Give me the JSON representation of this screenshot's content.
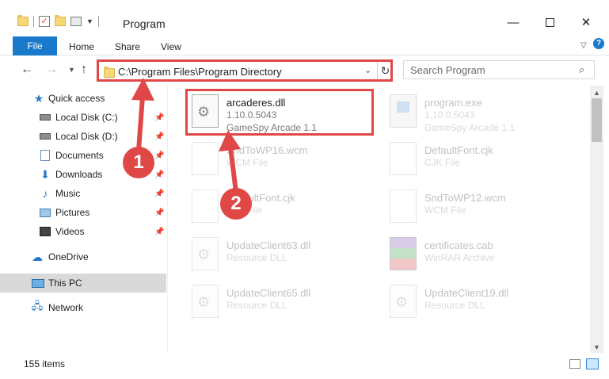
{
  "window": {
    "title": "Program",
    "minimize_glyph": "—",
    "close_glyph": "✕"
  },
  "ribbon": {
    "tabs": [
      "File",
      "Home",
      "Share",
      "View"
    ]
  },
  "address": {
    "path": "C:\\Program Files\\Program Directory"
  },
  "search": {
    "placeholder": "Search Program"
  },
  "sidebar": {
    "items": [
      {
        "label": "Quick access",
        "icon": "star-icon"
      },
      {
        "label": "Local Disk (C:)",
        "icon": "drive-icon"
      },
      {
        "label": "Local Disk (D:)",
        "icon": "drive-icon"
      },
      {
        "label": "Documents",
        "icon": "documents-icon"
      },
      {
        "label": "Downloads",
        "icon": "download-icon"
      },
      {
        "label": "Music",
        "icon": "music-icon"
      },
      {
        "label": "Pictures",
        "icon": "pictures-icon"
      },
      {
        "label": "Videos",
        "icon": "videos-icon"
      },
      {
        "label": "OneDrive",
        "icon": "cloud-icon"
      },
      {
        "label": "This PC",
        "icon": "computer-icon"
      },
      {
        "label": "Network",
        "icon": "network-icon"
      }
    ]
  },
  "files": [
    {
      "name": "arcaderes.dll",
      "line2": "1.10.0.5043",
      "line3": "GameSpy Arcade 1.1",
      "type": "dll"
    },
    {
      "name": "program.exe",
      "line2": "1.10.0.5043",
      "line3": "GameSpy Arcade 1.1",
      "type": "exe"
    },
    {
      "name": "SndToWP16.wcm",
      "line2": "WCM File",
      "line3": "",
      "type": "doc"
    },
    {
      "name": "DefaultFont.cjk",
      "line2": "CJK File",
      "line3": "",
      "type": "doc"
    },
    {
      "name": "DefaultFont.cjk",
      "line2": "CJK File",
      "line3": "",
      "type": "doc"
    },
    {
      "name": "SndToWP12.wcm",
      "line2": "WCM File",
      "line3": "",
      "type": "doc"
    },
    {
      "name": "UpdateClient63.dll",
      "line2": "Resource DLL",
      "line3": "",
      "type": "dll"
    },
    {
      "name": "certificates.cab",
      "line2": "WinRAR Archive",
      "line3": "",
      "type": "cab"
    },
    {
      "name": "UpdateClient65.dll",
      "line2": "Resource DLL",
      "line3": "",
      "type": "dll"
    },
    {
      "name": "UpdateClient19.dll",
      "line2": "Resource DLL",
      "line3": "",
      "type": "dll"
    }
  ],
  "status": {
    "item_count": "155 items"
  },
  "annotations": {
    "step1": "1",
    "step2": "2",
    "color": "#e04848"
  }
}
